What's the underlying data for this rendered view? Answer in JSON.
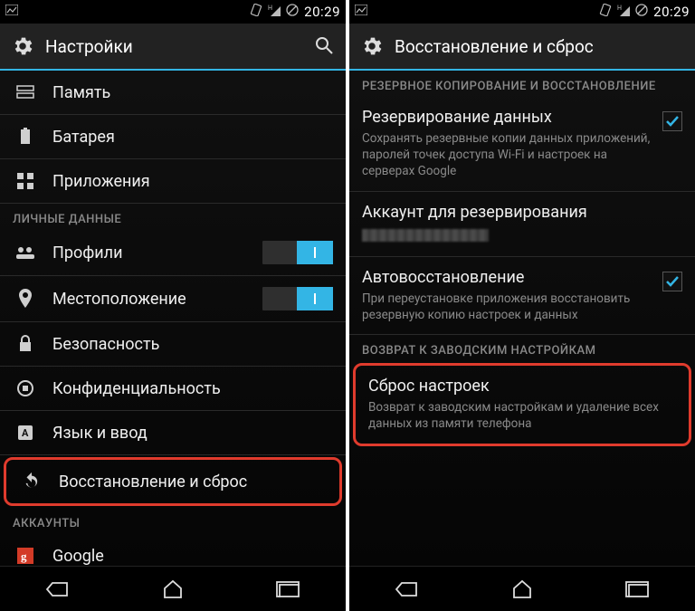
{
  "statusbar": {
    "time": "20:29"
  },
  "left": {
    "title": "Настройки",
    "items": {
      "memory": "Память",
      "battery": "Батарея",
      "apps": "Приложения"
    },
    "section_personal": "ЛИЧНЫЕ ДАННЫЕ",
    "personal": {
      "profiles": "Профили",
      "location": "Местоположение",
      "security": "Безопасность",
      "privacy": "Конфиденциальность",
      "language": "Язык и ввод",
      "backup_reset": "Восстановление и сброс"
    },
    "section_accounts": "АККАУНТЫ",
    "accounts": {
      "google": "Google"
    }
  },
  "right": {
    "title": "Восстановление и сброс",
    "section_backup": "РЕЗЕРВНОЕ КОПИРОВАНИЕ И ВОССТАНОВЛЕНИЕ",
    "backup_data": {
      "title": "Резервирование данных",
      "sub": "Сохранять резервные копии данных приложений, паролей точек доступа Wi-Fi и настроек на серверах Google"
    },
    "backup_account": {
      "title": "Аккаунт для резервирования"
    },
    "auto_restore": {
      "title": "Автовосстановление",
      "sub": "При переустановке приложения восстановить резервную копию настроек и данных"
    },
    "section_reset": "ВОЗВРАТ К ЗАВОДСКИМ НАСТРОЙКАМ",
    "factory_reset": {
      "title": "Сброс настроек",
      "sub": "Возврат к заводским настройкам и удаление всех данных из памяти телефона"
    }
  }
}
